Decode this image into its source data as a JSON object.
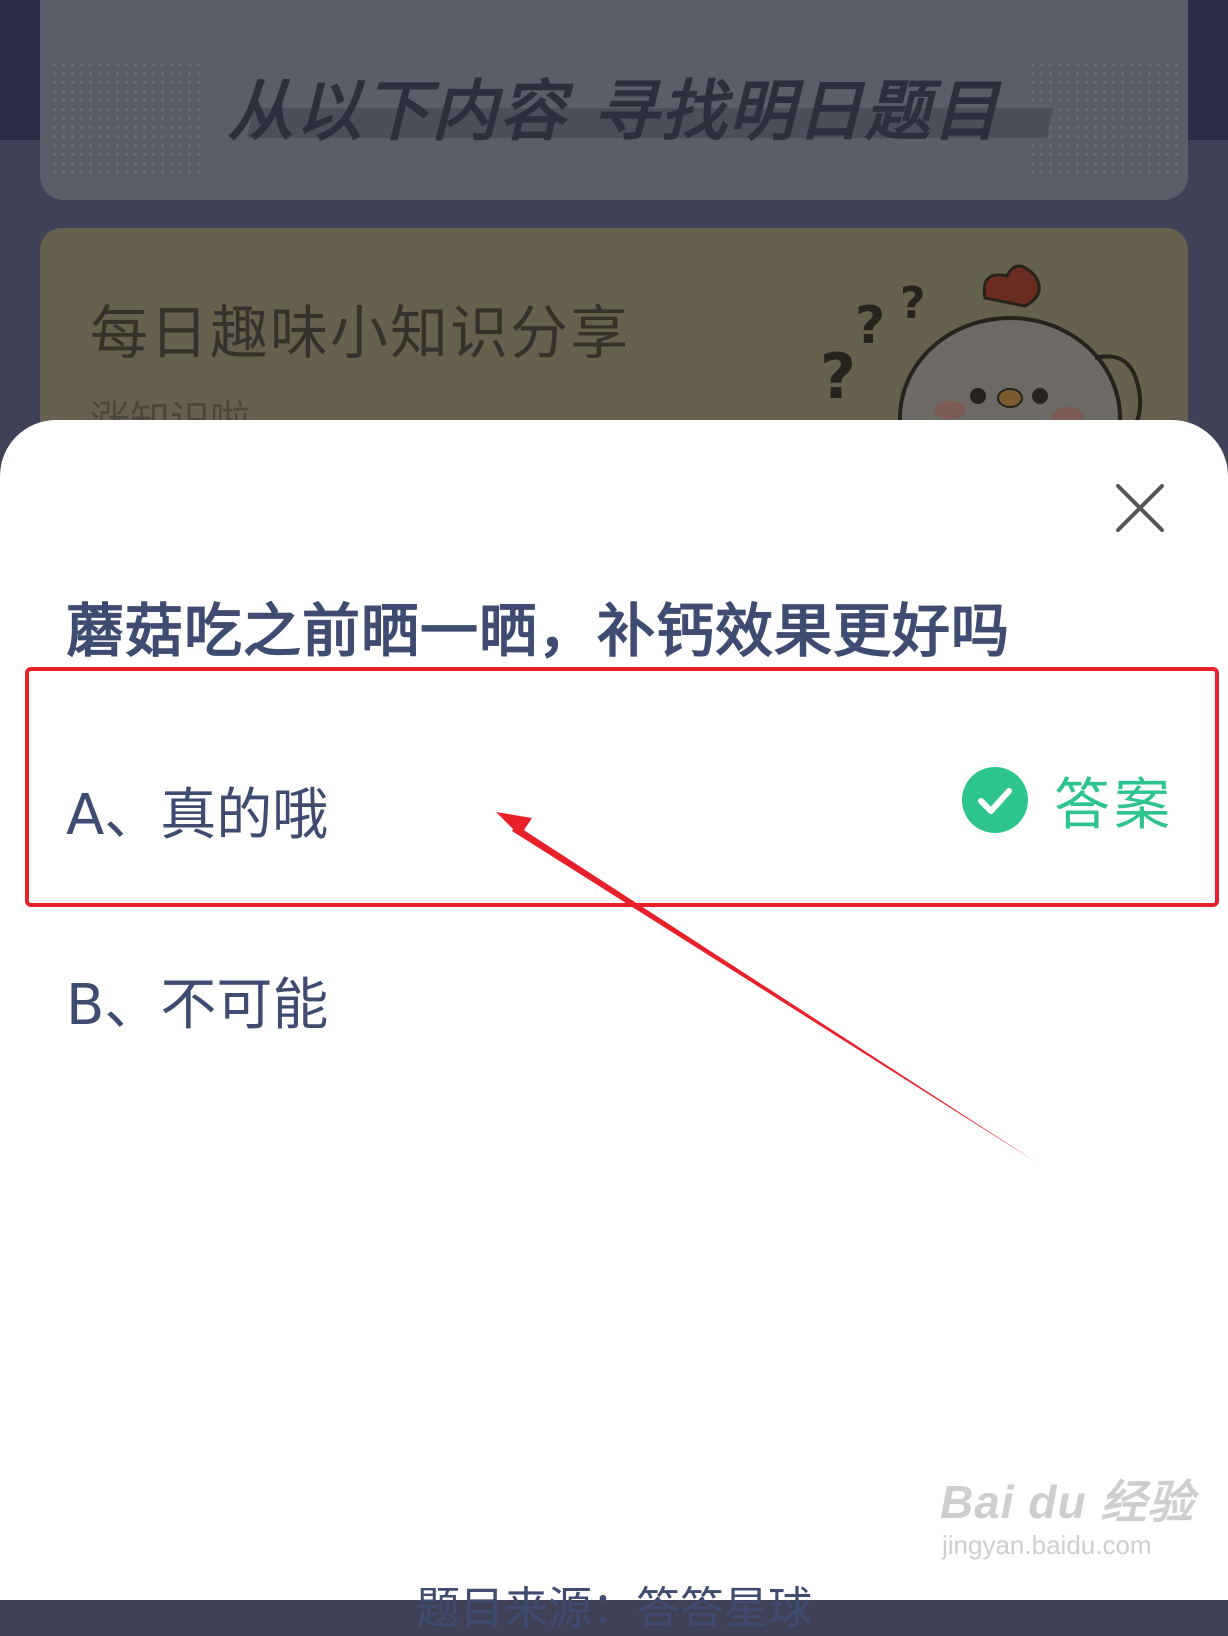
{
  "background": {
    "page_heading": "从以下内容 寻找明日题目",
    "topic_card": {
      "title": "每日趣味小知识分享",
      "subtitle": "涨知识啦"
    }
  },
  "sheet": {
    "question": "蘑菇吃之前晒一晒，补钙效果更好吗",
    "options": [
      {
        "label": "A、真的哦",
        "is_answer": true
      },
      {
        "label": "B、不可能",
        "is_answer": false
      }
    ],
    "answer_badge": {
      "label": "答案",
      "color": "#2ec48e"
    },
    "footer": "题目来源：答答星球"
  },
  "annotation": {
    "box_color": "#e8202a",
    "arrow_color": "#e8202a"
  },
  "watermark": {
    "logo": "Bai du 经验",
    "url": "jingyan.baidu.com"
  }
}
